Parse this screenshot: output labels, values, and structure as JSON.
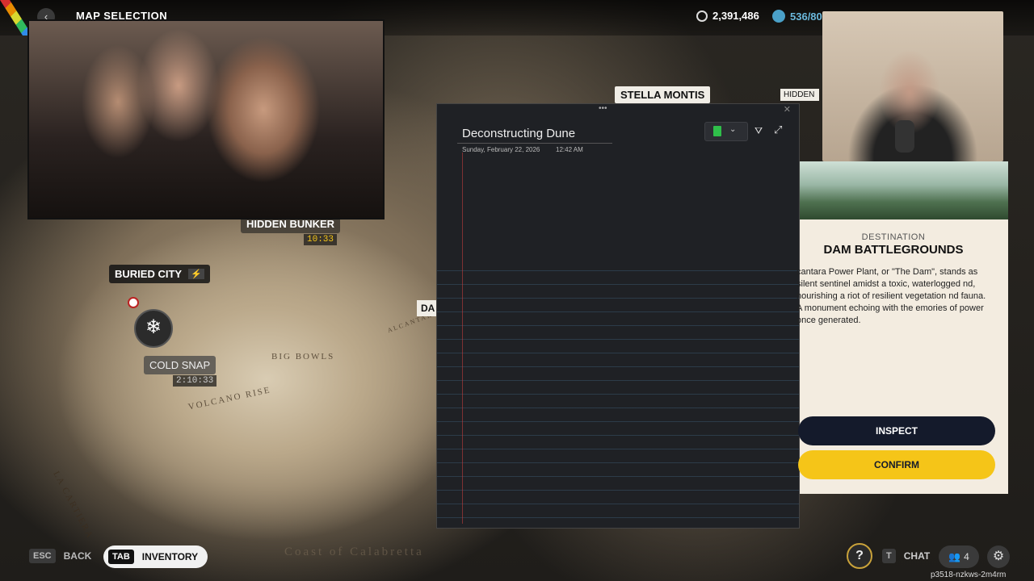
{
  "header": {
    "title": "MAP SELECTION",
    "coins": "2,391,486",
    "tokens": "536/80"
  },
  "map": {
    "locations": {
      "stella_montis": "STELLA MONTIS",
      "hidden_bunker": "HIDDEN BUNKER",
      "hidden_bunker_timer": "10:33",
      "buried_city": "BURIED CITY",
      "cold_snap": "COLD SNAP",
      "cold_snap_timer": "2:10:33",
      "dam_partial": "DA"
    },
    "terrain_labels": [
      "BIG BOWLS",
      "VOLCANO RISE",
      "LA CARTIERA",
      "Coast of Calabretta",
      "ALCANTARA"
    ]
  },
  "notes": {
    "title": "Deconstructing Dune",
    "date": "Sunday, February 22, 2026",
    "time": "12:42 AM"
  },
  "destination": {
    "label": "DESTINATION",
    "name": "DAM BATTLEGROUNDS",
    "description": "cantara Power Plant, or \"The Dam\", stands as silent sentinel amidst a toxic, waterlogged nd, nourishing a riot of resilient vegetation nd fauna. A monument echoing with the emories of power once generated.",
    "inspect": "INSPECT",
    "confirm": "CONFIRM"
  },
  "bottom": {
    "back_key": "ESC",
    "back_label": "BACK",
    "inventory_key": "TAB",
    "inventory_label": "INVENTORY",
    "chat_key": "T",
    "chat_label": "CHAT",
    "party_count": "4",
    "session_id": "p3518-nzkws-2m4rm"
  },
  "colors": {
    "confirm": "#f5c518",
    "inspect": "#141a2b",
    "panel": "#f3ece0"
  }
}
